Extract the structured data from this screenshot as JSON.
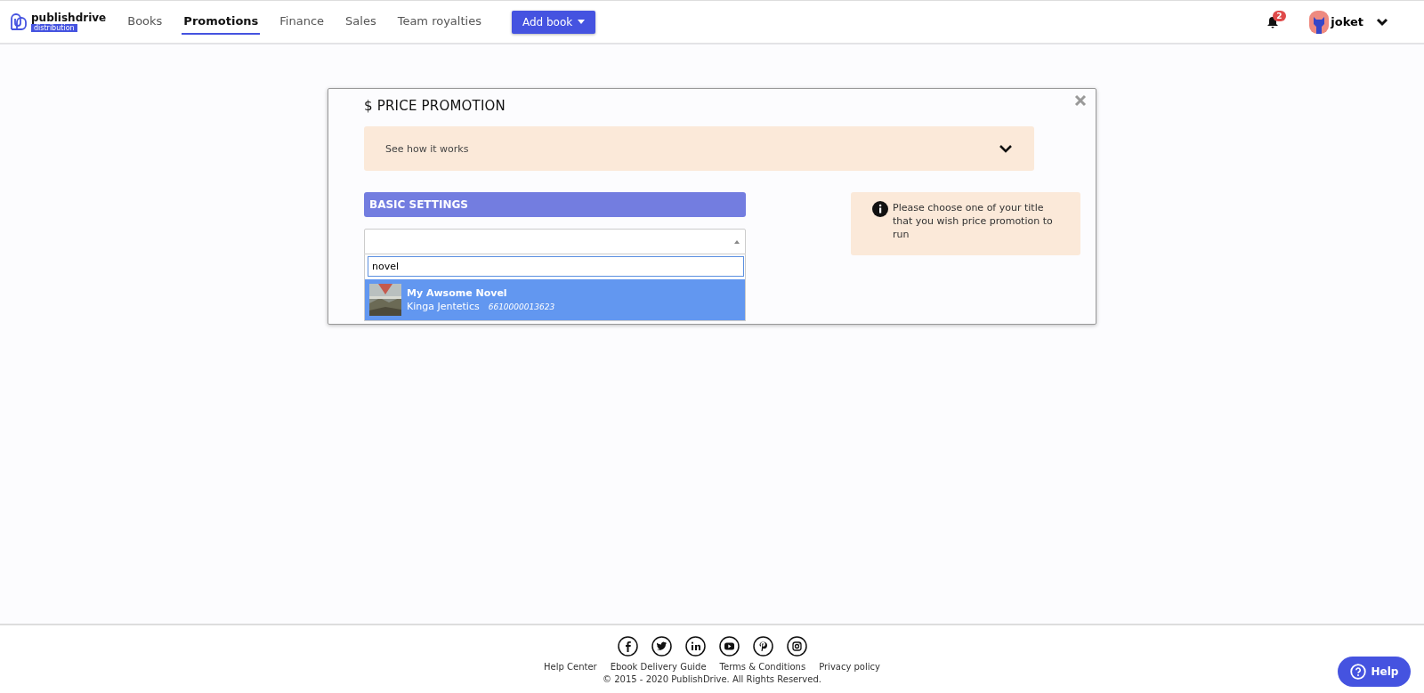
{
  "brand": {
    "name": "publishdrive",
    "tag": "distribution"
  },
  "nav": [
    {
      "label": "Books",
      "selected": false
    },
    {
      "label": "Promotions",
      "selected": true
    },
    {
      "label": "Finance",
      "selected": false
    },
    {
      "label": "Sales",
      "selected": false
    },
    {
      "label": "Team royalties",
      "selected": false
    }
  ],
  "add_button": "Add book",
  "notifications": {
    "count": "2"
  },
  "user": {
    "name": "joket"
  },
  "modal": {
    "title": "$ PRICE PROMOTION",
    "accordion": {
      "label": "See how it works",
      "expanded": false
    },
    "section": "BASIC SETTINGS",
    "select": {
      "search": "novel",
      "options": [
        {
          "title": "My Awsome Novel",
          "author": "Kinga Jentetics",
          "isbn": "6610000013623",
          "selected": true,
          "kind": "picture"
        }
      ]
    },
    "info": "Please choose one of your title that you wish price promotion to run"
  },
  "footer": {
    "links": [
      "Help Center",
      "Ebook Delivery Guide",
      "Terms & Conditions",
      "Privacy policy"
    ],
    "copyright": "© 2015 - 2020 PublishDrive. All Rights Reserved."
  },
  "help_button": "Help"
}
